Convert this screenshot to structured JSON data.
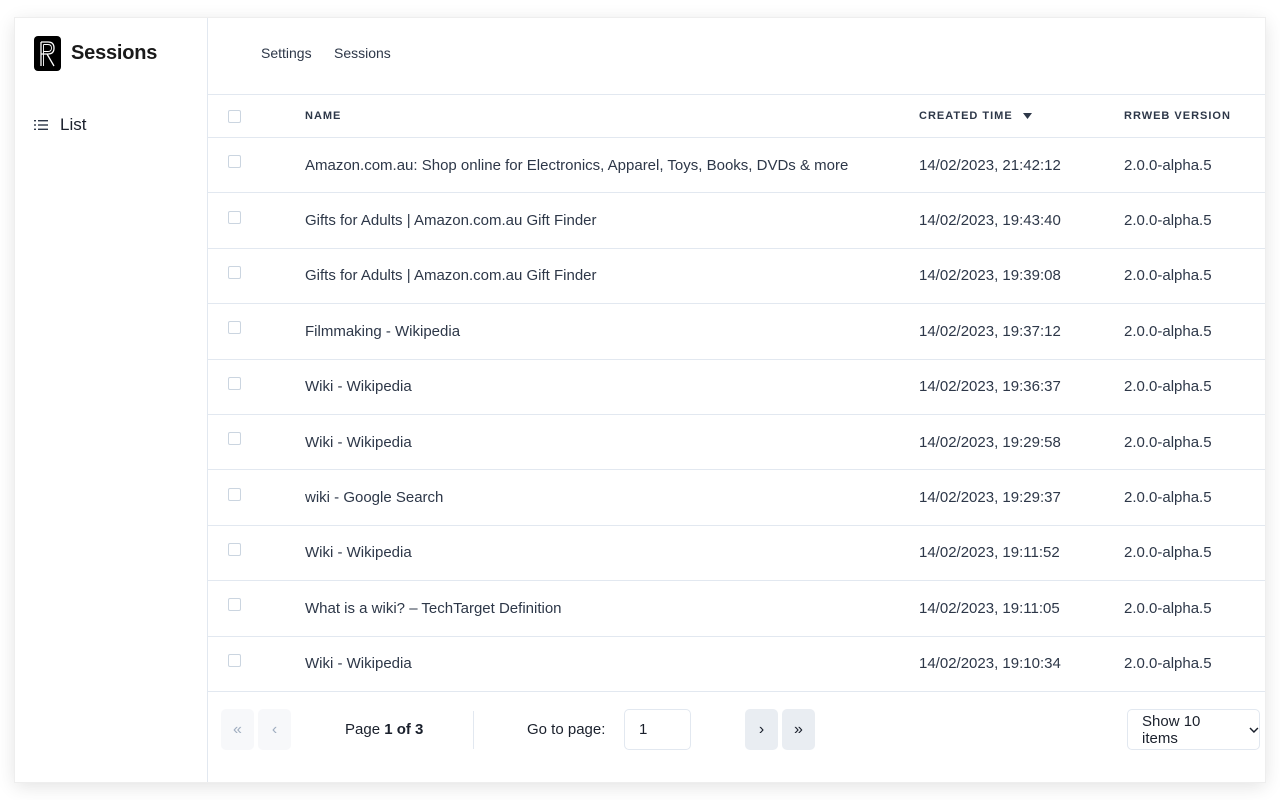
{
  "app": {
    "title": "Sessions",
    "logo_letter": "R"
  },
  "sidebar": {
    "items": [
      {
        "label": "List",
        "icon": "list-icon"
      }
    ]
  },
  "breadcrumb": [
    {
      "label": "Settings"
    },
    {
      "label": "Sessions"
    }
  ],
  "table": {
    "columns": {
      "name": "NAME",
      "created_time": "CREATED TIME",
      "version": "RRWEB VERSION"
    },
    "sort": {
      "column": "created_time",
      "direction": "desc",
      "icon": "sort-down-icon"
    },
    "rows": [
      {
        "name": "Amazon.com.au: Shop online for Electronics, Apparel, Toys, Books, DVDs & more",
        "created_time": "14/02/2023, 21:42:12",
        "version": "2.0.0-alpha.5"
      },
      {
        "name": "Gifts for Adults | Amazon.com.au Gift Finder",
        "created_time": "14/02/2023, 19:43:40",
        "version": "2.0.0-alpha.5"
      },
      {
        "name": "Gifts for Adults | Amazon.com.au Gift Finder",
        "created_time": "14/02/2023, 19:39:08",
        "version": "2.0.0-alpha.5"
      },
      {
        "name": "Filmmaking - Wikipedia",
        "created_time": "14/02/2023, 19:37:12",
        "version": "2.0.0-alpha.5"
      },
      {
        "name": "Wiki - Wikipedia",
        "created_time": "14/02/2023, 19:36:37",
        "version": "2.0.0-alpha.5"
      },
      {
        "name": "Wiki - Wikipedia",
        "created_time": "14/02/2023, 19:29:58",
        "version": "2.0.0-alpha.5"
      },
      {
        "name": "wiki - Google Search",
        "created_time": "14/02/2023, 19:29:37",
        "version": "2.0.0-alpha.5"
      },
      {
        "name": "Wiki - Wikipedia",
        "created_time": "14/02/2023, 19:11:52",
        "version": "2.0.0-alpha.5"
      },
      {
        "name": "What is a wiki? – TechTarget Definition",
        "created_time": "14/02/2023, 19:11:05",
        "version": "2.0.0-alpha.5"
      },
      {
        "name": "Wiki - Wikipedia",
        "created_time": "14/02/2023, 19:10:34",
        "version": "2.0.0-alpha.5"
      }
    ]
  },
  "pagination": {
    "first_label": "«",
    "prev_label": "‹",
    "next_label": "›",
    "last_label": "»",
    "page_prefix": "Page ",
    "page_current": "1",
    "page_of": " of ",
    "page_total": "3",
    "goto_label": "Go to page:",
    "goto_value": "1",
    "page_size_label": "Show 10 items"
  }
}
